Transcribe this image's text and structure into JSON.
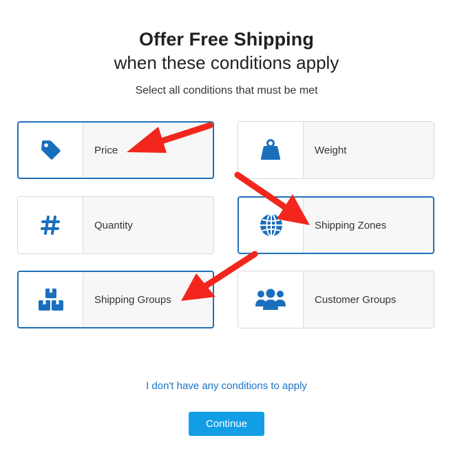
{
  "header": {
    "title": "Offer Free Shipping",
    "subtitle": "when these conditions apply",
    "instructions": "Select all conditions that must be met"
  },
  "conditions": [
    {
      "label": "Price",
      "icon": "price-tag-icon",
      "selected": true
    },
    {
      "label": "Weight",
      "icon": "weight-icon",
      "selected": false
    },
    {
      "label": "Quantity",
      "icon": "hash-icon",
      "selected": false
    },
    {
      "label": "Shipping Zones",
      "icon": "globe-icon",
      "selected": true
    },
    {
      "label": "Shipping Groups",
      "icon": "boxes-icon",
      "selected": true
    },
    {
      "label": "Customer Groups",
      "icon": "users-icon",
      "selected": false
    }
  ],
  "footer": {
    "no_conditions_link": "I don't have any conditions to apply",
    "continue_label": "Continue"
  },
  "colors": {
    "accent": "#1f6fb8",
    "icon": "#1a6fbd",
    "button": "#129ee6",
    "annotation_arrow": "#f2261c"
  }
}
